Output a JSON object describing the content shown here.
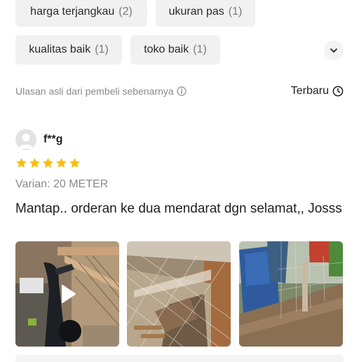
{
  "tags": [
    {
      "label": "harga terjangkau",
      "count": "(2)"
    },
    {
      "label": "ukuran pas",
      "count": "(1)"
    },
    {
      "label": "kualitas baik",
      "count": "(1)"
    },
    {
      "label": "toko baik",
      "count": "(1)"
    }
  ],
  "expand_icon": "chevron-down-icon",
  "review_meta": {
    "note": "Ulasan asli dari pembeli sebenarnya",
    "note_icon": "info-icon",
    "sort_label": "Terbaru",
    "sort_icon": "clock-icon"
  },
  "review": {
    "username": "f**g",
    "rating": 5,
    "rating_max": 5,
    "variant": "Varian: 20 METER",
    "text": "Mantap.. orderan ke dua mendarat dgn selamat,, Josss",
    "media": [
      {
        "type": "video",
        "icon": "play-icon"
      },
      {
        "type": "image"
      },
      {
        "type": "image"
      }
    ]
  },
  "colors": {
    "star": "#fbbd08",
    "chip_bg": "#f1f1f1",
    "muted_text": "#8a8a8a"
  }
}
